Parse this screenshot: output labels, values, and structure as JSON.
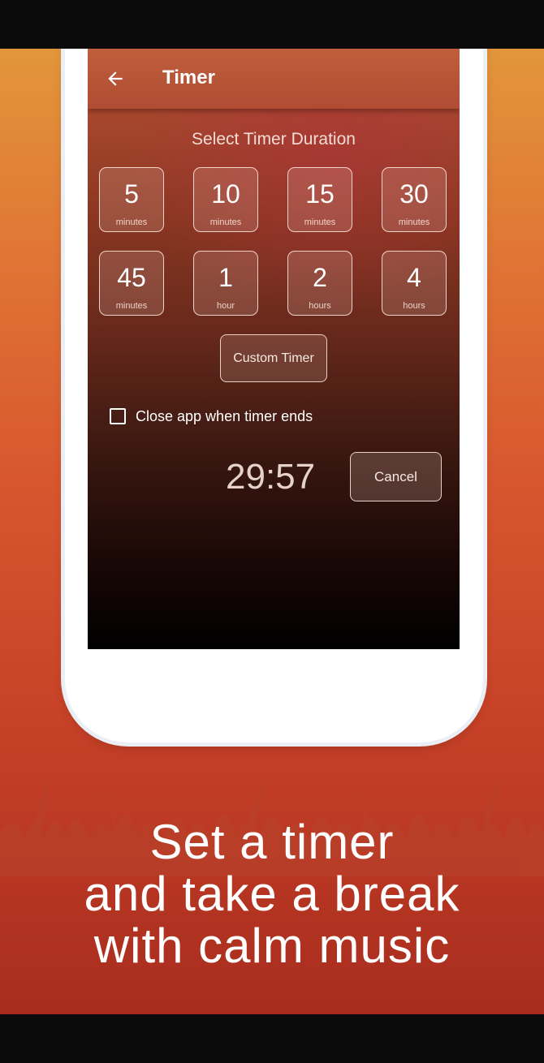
{
  "appbar": {
    "title": "Timer",
    "back_icon": "arrow-left-icon"
  },
  "timer": {
    "section_title": "Select Timer Duration",
    "options": [
      {
        "value": "5",
        "unit": "minutes"
      },
      {
        "value": "10",
        "unit": "minutes"
      },
      {
        "value": "15",
        "unit": "minutes"
      },
      {
        "value": "30",
        "unit": "minutes"
      },
      {
        "value": "45",
        "unit": "minutes"
      },
      {
        "value": "1",
        "unit": "hour"
      },
      {
        "value": "2",
        "unit": "hours"
      },
      {
        "value": "4",
        "unit": "hours"
      }
    ],
    "custom_label": "Custom Timer",
    "close_app_label": "Close app when timer ends",
    "close_app_checked": false,
    "countdown": "29:57",
    "cancel_label": "Cancel"
  },
  "promo": {
    "line1": "Set a timer",
    "line2": "and take a break",
    "line3": "with calm music"
  }
}
